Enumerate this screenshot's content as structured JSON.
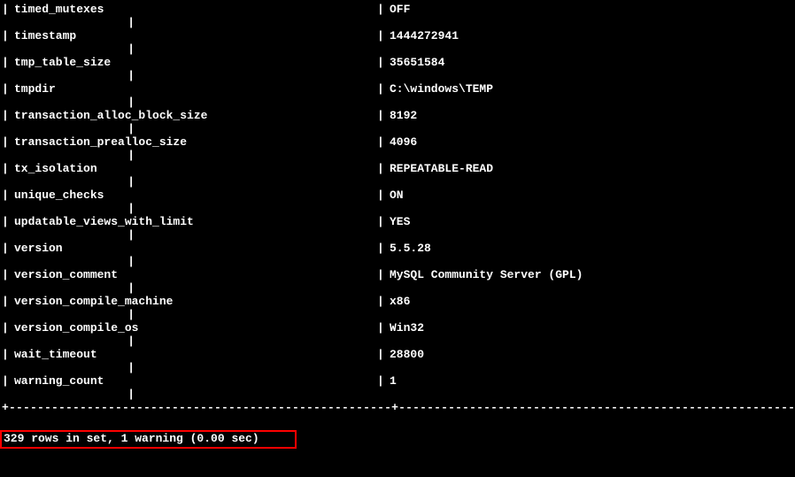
{
  "rows": [
    {
      "name": "timed_mutexes",
      "value": "OFF"
    },
    {
      "name": "timestamp",
      "value": "1444272941"
    },
    {
      "name": "tmp_table_size",
      "value": "35651584"
    },
    {
      "name": "tmpdir",
      "value": "C:\\windows\\TEMP"
    },
    {
      "name": "transaction_alloc_block_size",
      "value": "8192"
    },
    {
      "name": "transaction_prealloc_size",
      "value": "4096"
    },
    {
      "name": "tx_isolation",
      "value": "REPEATABLE-READ"
    },
    {
      "name": "unique_checks",
      "value": "ON"
    },
    {
      "name": "updatable_views_with_limit",
      "value": "YES"
    },
    {
      "name": "version",
      "value": "5.5.28"
    },
    {
      "name": "version_comment",
      "value": "MySQL Community Server (GPL)"
    },
    {
      "name": "version_compile_machine",
      "value": "x86"
    },
    {
      "name": "version_compile_os",
      "value": "Win32"
    },
    {
      "name": "wait_timeout",
      "value": "28800"
    },
    {
      "name": "warning_count",
      "value": "1"
    }
  ],
  "pipe": "|",
  "blank_sep": "|",
  "separator": "+------------------------------------------------------+------------------------------------------------------------+",
  "status": "329 rows in set, 1 warning (0.00 sec)"
}
